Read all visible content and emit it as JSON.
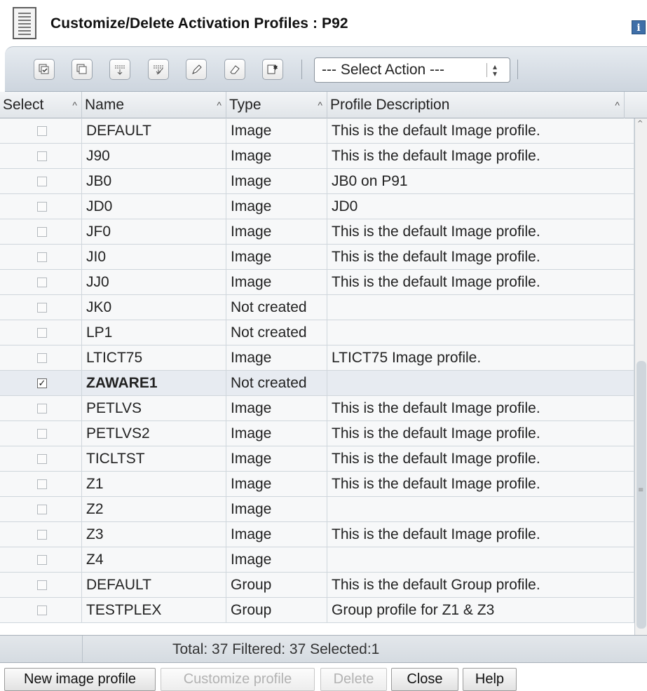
{
  "window": {
    "title": "Customize/Delete Activation Profiles : P92",
    "info_icon": "info-icon",
    "info_glyph": "i"
  },
  "toolbar": {
    "icons": [
      "select-all-icon",
      "copy-icon",
      "filter-icon",
      "edit-filter-icon",
      "customize-icon",
      "clear-icon",
      "configure-columns-icon"
    ],
    "select_action": "--- Select Action ---"
  },
  "table": {
    "columns": [
      "Select",
      "Name",
      "Type",
      "Profile Description"
    ],
    "rows": [
      {
        "selected": false,
        "name": "DEFAULT",
        "type": "Image",
        "description": "This is the default Image profile."
      },
      {
        "selected": false,
        "name": "J90",
        "type": "Image",
        "description": "This is the default Image profile."
      },
      {
        "selected": false,
        "name": "JB0",
        "type": "Image",
        "description": "JB0 on P91"
      },
      {
        "selected": false,
        "name": "JD0",
        "type": "Image",
        "description": "JD0"
      },
      {
        "selected": false,
        "name": "JF0",
        "type": "Image",
        "description": "This is the default Image profile."
      },
      {
        "selected": false,
        "name": "JI0",
        "type": "Image",
        "description": "This is the default Image profile."
      },
      {
        "selected": false,
        "name": "JJ0",
        "type": "Image",
        "description": "This is the default Image profile."
      },
      {
        "selected": false,
        "name": "JK0",
        "type": "Not created",
        "description": ""
      },
      {
        "selected": false,
        "name": "LP1",
        "type": "Not created",
        "description": ""
      },
      {
        "selected": false,
        "name": "LTICT75",
        "type": "Image",
        "description": "LTICT75 Image profile."
      },
      {
        "selected": true,
        "name": "ZAWARE1",
        "type": "Not created",
        "description": ""
      },
      {
        "selected": false,
        "name": "PETLVS",
        "type": "Image",
        "description": "This is the default Image profile."
      },
      {
        "selected": false,
        "name": "PETLVS2",
        "type": "Image",
        "description": "This is the default Image profile."
      },
      {
        "selected": false,
        "name": "TICLTST",
        "type": "Image",
        "description": "This is the default Image profile."
      },
      {
        "selected": false,
        "name": "Z1",
        "type": "Image",
        "description": "This is the default Image profile."
      },
      {
        "selected": false,
        "name": "Z2",
        "type": "Image",
        "description": ""
      },
      {
        "selected": false,
        "name": "Z3",
        "type": "Image",
        "description": "This is the default Image profile."
      },
      {
        "selected": false,
        "name": "Z4",
        "type": "Image",
        "description": ""
      },
      {
        "selected": false,
        "name": "DEFAULT",
        "type": "Group",
        "description": "This is the default Group profile."
      },
      {
        "selected": false,
        "name": "TESTPLEX",
        "type": "Group",
        "description": "Group profile for Z1 & Z3"
      }
    ]
  },
  "footer": {
    "summary": "Total: 37   Filtered: 37   Selected:1"
  },
  "buttons": {
    "new_image_profile": "New image profile",
    "customize_profile": "Customize profile",
    "delete": "Delete",
    "close": "Close",
    "help": "Help"
  }
}
